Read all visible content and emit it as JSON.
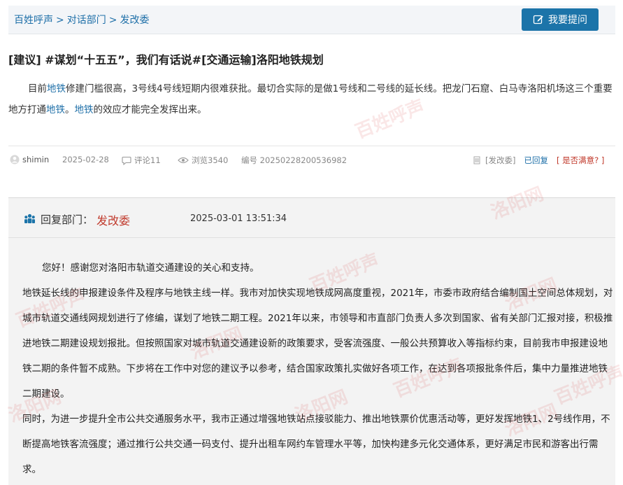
{
  "breadcrumb": {
    "items": [
      "百姓呼声",
      "对话部门",
      "发改委"
    ],
    "separator": ">"
  },
  "ask_button": {
    "label": "我要提问"
  },
  "post": {
    "tag": "[建议]",
    "title_text": "#谋划“十五五”，我们有话说#[交通运输]洛阳地铁规划",
    "content": {
      "seg1": "目前",
      "link1": "地铁",
      "seg2": "修建门槛很高，3号线4号线短期内很难获批。最切合实际的是做1号线和二号线的延长线。把龙门石窟、白马寺洛阳机场这三个重要地方打通",
      "link2": "地铁",
      "seg3": "。",
      "link3": "地铁",
      "seg4": "的效应才能完全发挥出来。"
    }
  },
  "meta": {
    "user": "shimin",
    "date": "2025-02-28",
    "comments": "评论11",
    "views": "浏览3540",
    "serial": "编号 20250228200536982",
    "dept": "[发改委]",
    "status": "已回复",
    "satisfied": "[ 是否满意? ]"
  },
  "reply": {
    "label": "回复部门：",
    "dept": "发改委",
    "datetime": "2025-03-01 13:51:34",
    "greeting": "您好！感谢您对洛阳市轨道交通建设的关心和支持。",
    "para1": "地铁延长线的申报建设条件及程序与地铁主线一样。我市对加快实现地铁成网高度重视，2021年，市委市政府结合编制国土空间总体规划，对城市轨道交通线网规划进行了修编，谋划了地铁二期工程。2021年以来，市领导和市直部门负责人多次到国家、省有关部门汇报对接，积极推进地铁二期建设规划报批。但按照国家对城市轨道交通建设新的政策要求，受客流强度、一般公共预算收入等指标约束，目前我市申报建设地铁二期的条件暂不成熟。下步将在工作中对您的建议予以参考，结合国家政策扎实做好各项工作，在达到各项报批条件后，集中力量推进地铁二期建设。",
    "para2": "同时，为进一步提升全市公共交通服务水平，我市正通过增强地铁站点接驳能力、推出地铁票价优惠活动等，更好发挥地铁1、2号线作用，不断提高地铁客流强度；通过推行公共交通一码支付、提升出租车网约车管理水平等，加快构建多元化交通体系，更好满足市民和游客出行需求。"
  },
  "watermark": {
    "text1": "百姓呼声",
    "text2": "洛阳网"
  }
}
